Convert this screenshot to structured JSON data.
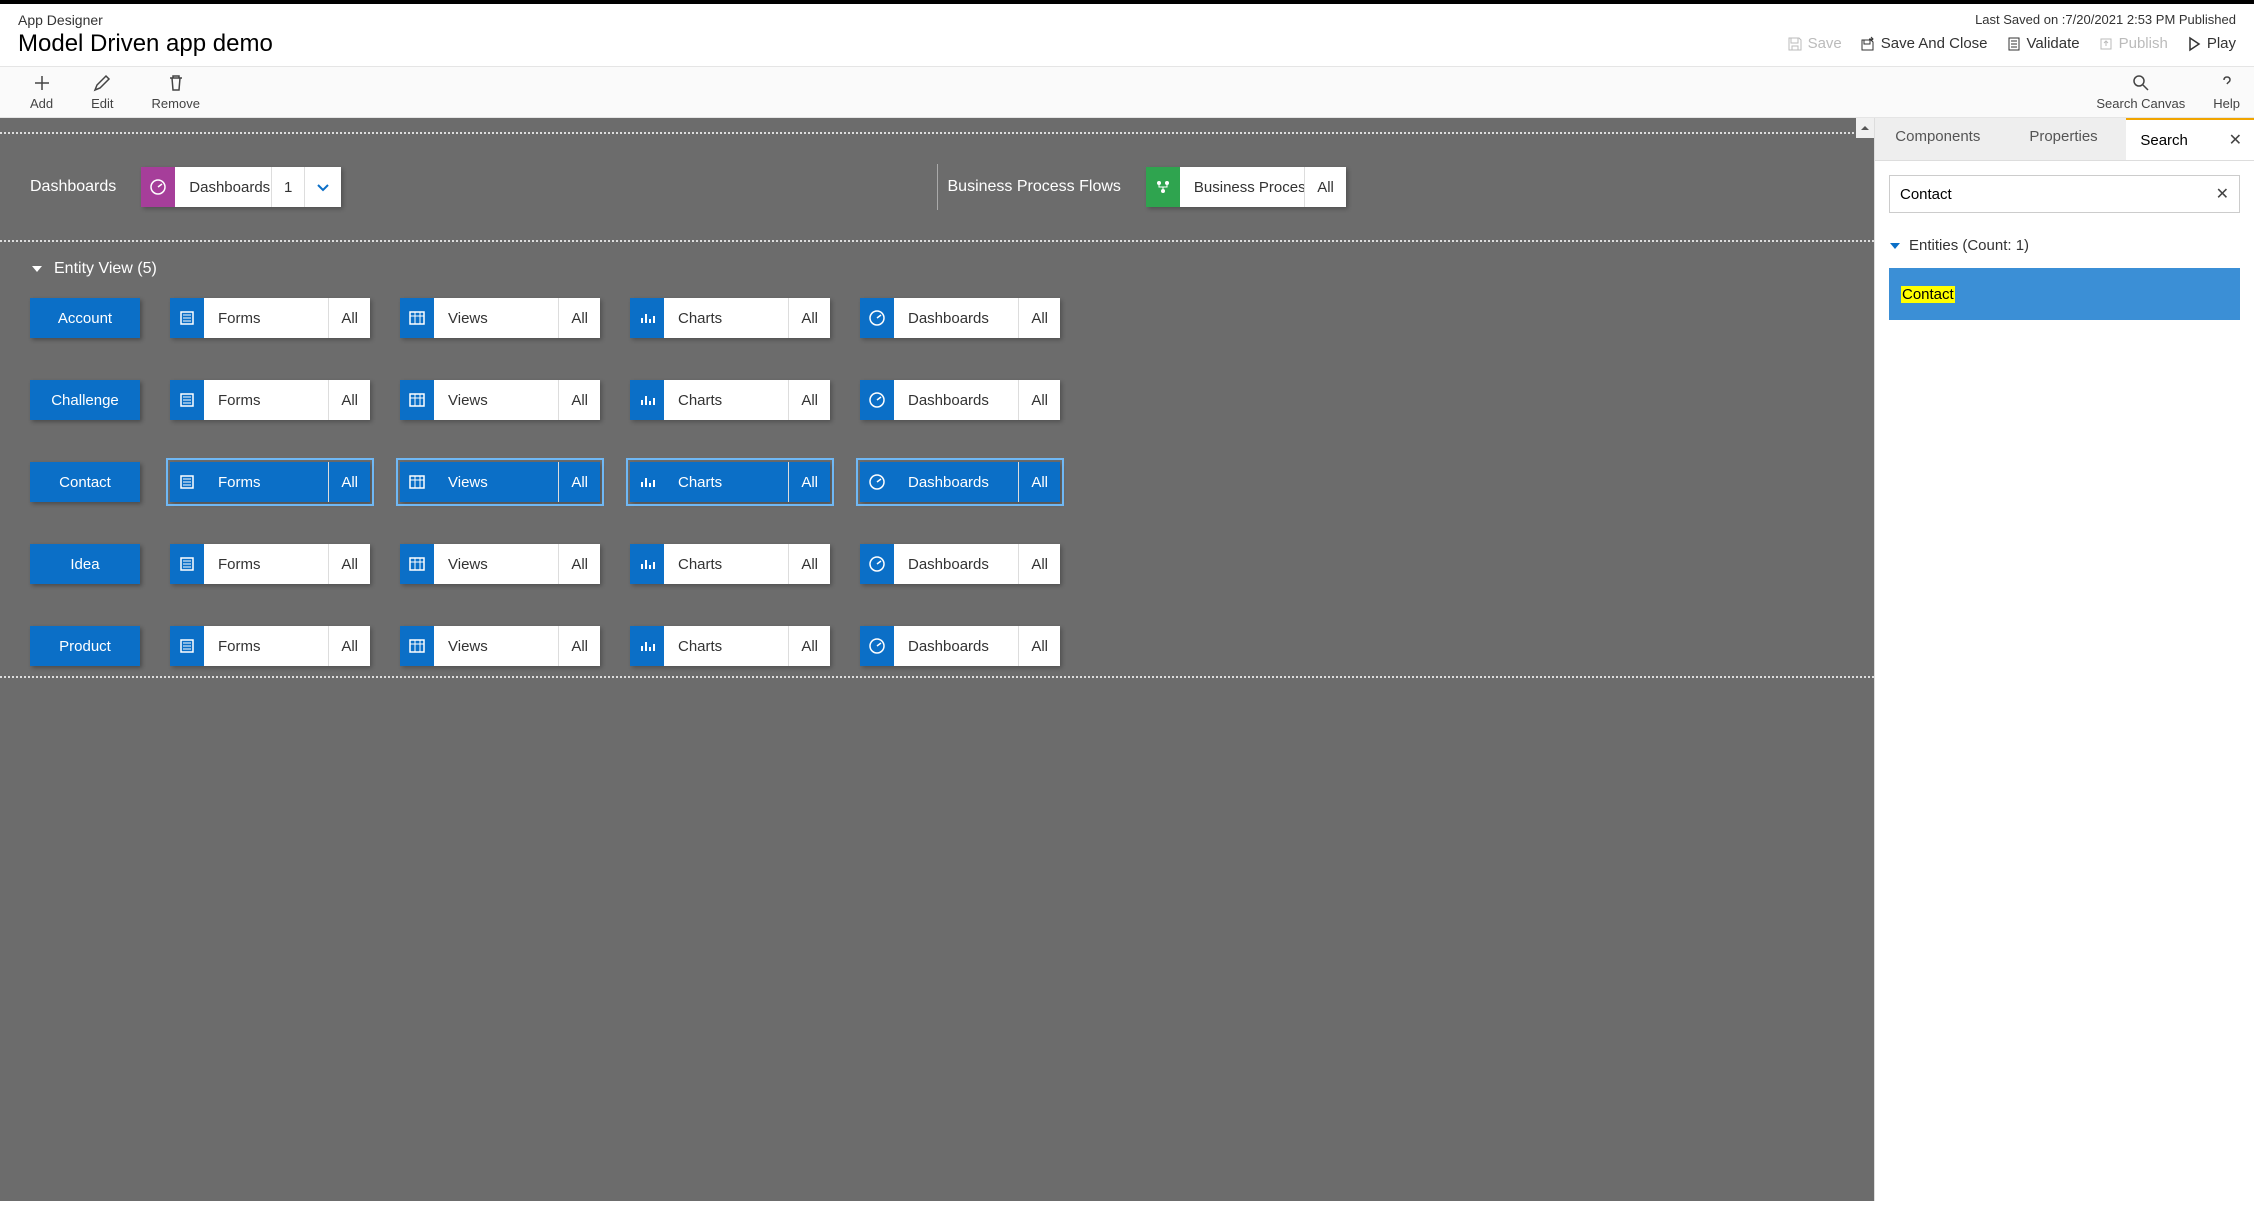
{
  "header": {
    "app_designer_label": "App Designer",
    "app_title": "Model Driven app demo",
    "last_saved": "Last Saved on :7/20/2021 2:53 PM Published",
    "save": "Save",
    "save_close": "Save And Close",
    "validate": "Validate",
    "publish": "Publish",
    "play": "Play"
  },
  "toolbar": {
    "add": "Add",
    "edit": "Edit",
    "remove": "Remove",
    "search_canvas": "Search Canvas",
    "help": "Help"
  },
  "canvas": {
    "dashboards_label": "Dashboards",
    "dashboards_tile": "Dashboards",
    "dashboards_count": "1",
    "bpf_label": "Business Process Flows",
    "bpf_tile": "Business Proces...",
    "bpf_count": "All",
    "entity_view_label": "Entity View (5)",
    "entities": [
      {
        "name": "Account",
        "selected": false
      },
      {
        "name": "Challenge",
        "selected": false
      },
      {
        "name": "Contact",
        "selected": true
      },
      {
        "name": "Idea",
        "selected": false
      },
      {
        "name": "Product",
        "selected": false
      }
    ],
    "cols": [
      {
        "label": "Forms",
        "count": "All",
        "icon": "form"
      },
      {
        "label": "Views",
        "count": "All",
        "icon": "view"
      },
      {
        "label": "Charts",
        "count": "All",
        "icon": "chart"
      },
      {
        "label": "Dashboards",
        "count": "All",
        "icon": "dashboard"
      }
    ]
  },
  "sidepanel": {
    "tabs": {
      "components": "Components",
      "properties": "Properties",
      "search": "Search"
    },
    "search_value": "Contact",
    "entities_header": "Entities (Count: 1)",
    "result": "Contact"
  }
}
